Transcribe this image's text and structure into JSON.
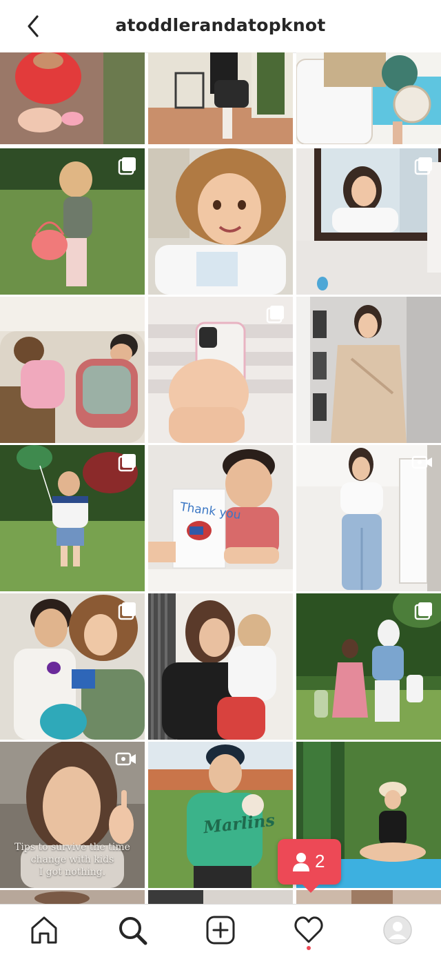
{
  "header": {
    "username": "atoddlerandatopknot",
    "back_icon": "chevron-left-icon"
  },
  "grid": {
    "tiles": [
      {
        "id": "r0c0",
        "type": "photo",
        "subject": "child crouching on brick path"
      },
      {
        "id": "r0c1",
        "type": "photo",
        "subject": "woman with bag on patio"
      },
      {
        "id": "r0c2",
        "type": "photo",
        "subject": "pool chair and hat"
      },
      {
        "id": "r1c0",
        "type": "carousel",
        "subject": "toddler with easter basket"
      },
      {
        "id": "r1c1",
        "type": "photo",
        "subject": "girl with curly hair"
      },
      {
        "id": "r1c2",
        "type": "carousel",
        "subject": "woman brushing teeth in mirror"
      },
      {
        "id": "r2c0",
        "type": "photo",
        "subject": "kids sleeping on couch"
      },
      {
        "id": "r2c1",
        "type": "carousel",
        "subject": "hand holding phone"
      },
      {
        "id": "r2c2",
        "type": "photo",
        "subject": "woman in satin wrap dress"
      },
      {
        "id": "r3c0",
        "type": "carousel",
        "subject": "toddler with balloon"
      },
      {
        "id": "r3c1",
        "type": "photo",
        "subject": "boy with thank you card",
        "card_text": "Thank you"
      },
      {
        "id": "r3c2",
        "type": "video",
        "subject": "woman in jeans"
      },
      {
        "id": "r4c0",
        "type": "carousel",
        "subject": "kids with easter basket"
      },
      {
        "id": "r4c1",
        "type": "photo",
        "subject": "mother holding toddler"
      },
      {
        "id": "r4c2",
        "type": "carousel",
        "subject": "family with easter bunny"
      },
      {
        "id": "r5c0",
        "type": "video",
        "subject": "woman pointing",
        "caption": "Tips to survive the time change with kids \nI got nothing."
      },
      {
        "id": "r5c1",
        "type": "photo",
        "subject": "boy in marlins shirt",
        "shirt_text": "Marlins"
      },
      {
        "id": "r5c2",
        "type": "photo",
        "subject": "woman sitting by pool"
      }
    ]
  },
  "notification": {
    "count": "2",
    "icon": "person-icon",
    "color": "#ed4956"
  },
  "nav": {
    "items": [
      {
        "name": "home",
        "icon": "home-icon"
      },
      {
        "name": "search",
        "icon": "search-icon",
        "active": true
      },
      {
        "name": "new-post",
        "icon": "plus-square-icon"
      },
      {
        "name": "activity",
        "icon": "heart-icon",
        "has_dot": true
      },
      {
        "name": "profile",
        "icon": "avatar-icon"
      }
    ]
  },
  "colors": {
    "text": "#262626",
    "badge": "#ed4956",
    "divider": "#dbdbdb"
  }
}
